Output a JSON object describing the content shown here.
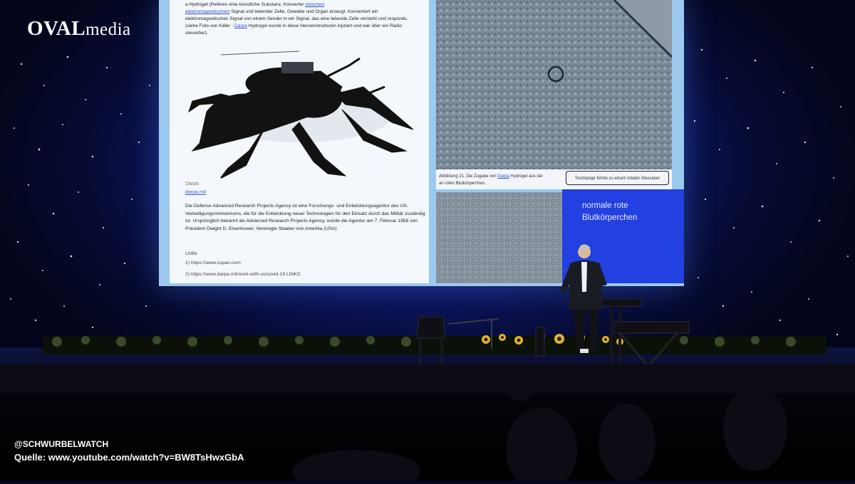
{
  "logo": {
    "brand_bold": "OVAL",
    "brand_light": "media"
  },
  "slide": {
    "intro_parts": {
      "a": "a Hydrogel (Referen",
      "b": " eine künstliche Substanz, ",
      "c": " Konver",
      "d": "ter ",
      "e": "zwischen",
      "f": "elektromagnetischem",
      "g": " Signal und lebender Zelle, Gewebe und Organ erzeugt. Konvertiert ein elektromagnetisches Signal von einem Sender in ein Signal, das eine lebende Zelle versteht und responds. (siehe Foto von Käfer - ",
      "h": "Darpa",
      "i": " Hydrogel wurde in diese Nervenstrukturen injiziert und war über ein Radio steuerbar)."
    },
    "source_label": "Darpa",
    "source_link": "darpa.mil",
    "description": "Die Defense Advanced Research Projects Agency ist eine Forschungs- und Entwicklungsagentur des US-Verteidigungsministeriums, die für die Entwicklung neuer Technologien für den Einsatz durch das Militär zuständig ist. Ursprünglich bekannt als Advanced Research Projects Agency, wurde die Agentur am 7. Februar 1958 von Präsident Dwight D. Eisenhower, Vereinigte Staaten von Amerika (USA)",
    "links_heading": "Links",
    "link1": "1) https://www.copan.com",
    "link2": "2) https://www.darpa.mil/work-with-us/covid-19 LINKS",
    "caption_a": "Abbildung 21. Die Zugabe von ",
    "caption_link": "Darpa",
    "caption_b": " Hydrogel aus der",
    "caption_c": "an roten Blutkörperchen.",
    "caption_box": "Teststange führte zu einem totalen Massaker",
    "blue_label_line1": "normale rote",
    "blue_label_line2": "Blutkörperchen"
  },
  "watermark": {
    "handle": "@SCHWURBELWATCH",
    "source": "Quelle: www.youtube.com/watch?v=BW8TsHwxGbA"
  },
  "colors": {
    "stage_blue": "#1a2f9a",
    "screen_blue": "#2340e0",
    "link_blue": "#2350c8"
  }
}
